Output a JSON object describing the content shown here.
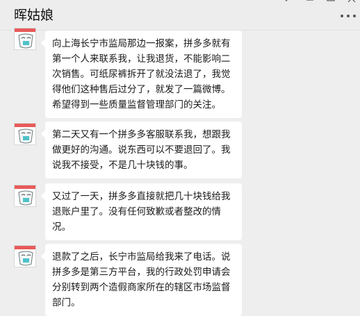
{
  "header": {
    "title": "晖姑娘",
    "more_icon": "more-dots-icon"
  },
  "messages": [
    {
      "avatar_icon": "sticker-avatar-icon",
      "text": "向上海长宁市监局那边一报案，拼多多就有第一个人来联系我，让我退货，不能影响二次销售。可纸尿裤拆开了就没法退了，我觉得他们这种售后过分了，就发了一篇微博。希望得到一些质量监督管理部门的关注。"
    },
    {
      "avatar_icon": "sticker-avatar-icon",
      "text": "第二天又有一个拼多多客服联系我，想跟我做更好的沟通。说东西可以不要退回了。我说我不接受，不是几十块钱的事。"
    },
    {
      "avatar_icon": "sticker-avatar-icon",
      "text": "又过了一天，拼多多直接就把几十块钱给我退账户里了。没有任何致歉或者整改的情况。"
    },
    {
      "avatar_icon": "sticker-avatar-icon",
      "text": "退款了之后，长宁市监局给我来了电话。说拼多多是第三方平台，我的行政处罚申请会分别转到两个造假商家所在的辖区市场监督部门。"
    }
  ]
}
